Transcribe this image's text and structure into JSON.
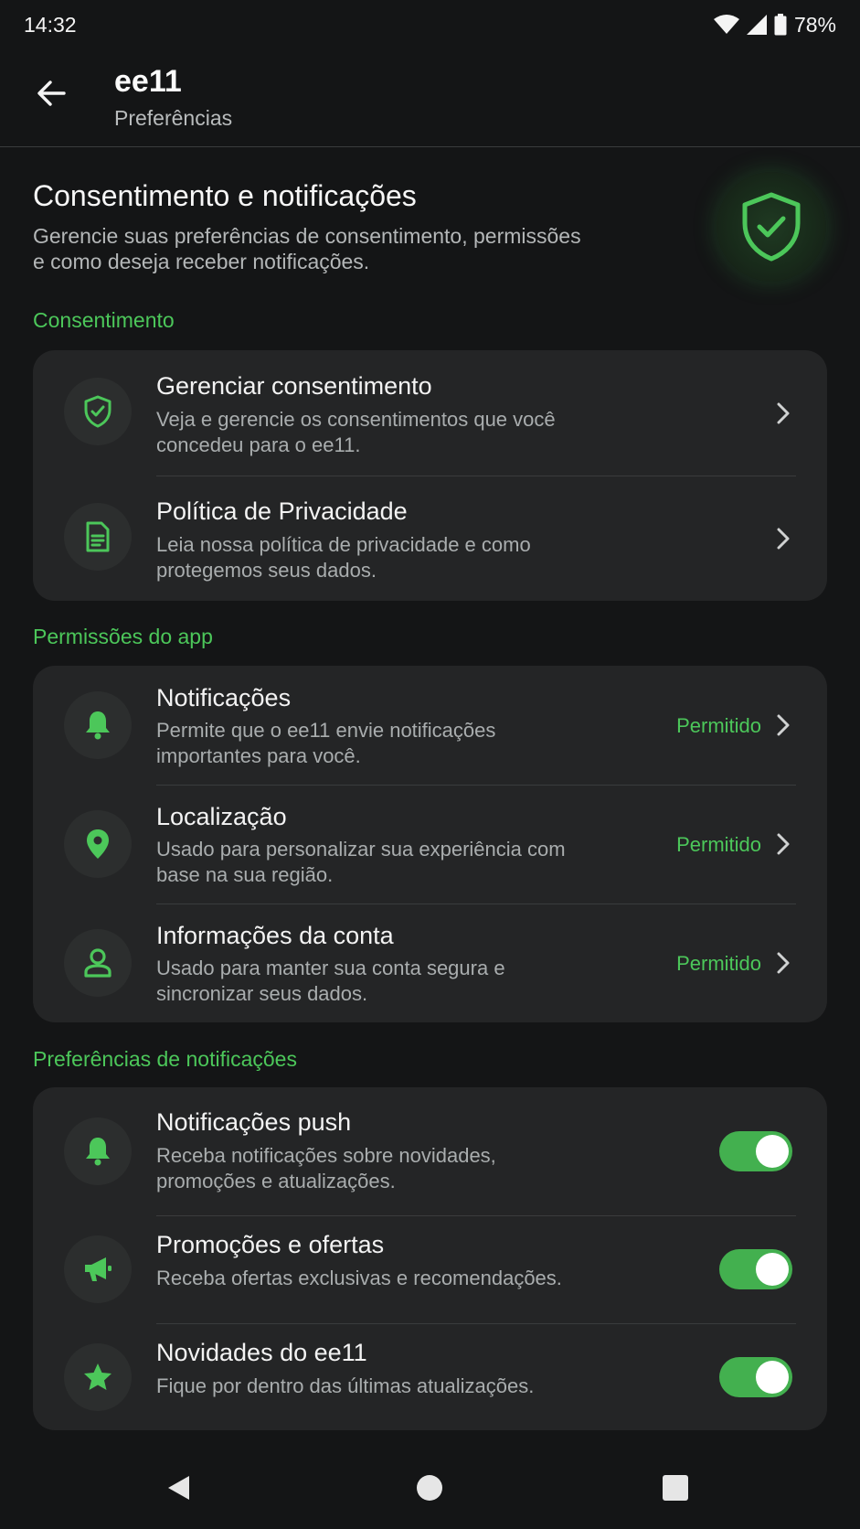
{
  "status_bar": {
    "time": "14:32",
    "battery": "78%"
  },
  "app_bar": {
    "title": "ee11",
    "subtitle": "Preferências"
  },
  "hero": {
    "title": "Consentimento e notificações",
    "description": "Gerencie suas preferências de consentimento, permissões e como deseja receber notificações."
  },
  "sections": {
    "consent": {
      "label": "Consentimento",
      "items": [
        {
          "icon": "shield-check-icon",
          "title": "Gerenciar consentimento",
          "description": "Veja e gerencie os consentimentos que você concedeu para o ee11."
        },
        {
          "icon": "document-icon",
          "title": "Política de Privacidade",
          "description": "Leia nossa política de privacidade e como protegemos seus dados."
        }
      ]
    },
    "permissions": {
      "label": "Permissões do app",
      "items": [
        {
          "icon": "bell-icon",
          "title": "Notificações",
          "description": "Permite que o ee11 envie notificações importantes para você.",
          "status": "Permitido"
        },
        {
          "icon": "location-pin-icon",
          "title": "Localização",
          "description": "Usado para personalizar sua experiência com base na sua região.",
          "status": "Permitido"
        },
        {
          "icon": "person-icon",
          "title": "Informações da conta",
          "description": "Usado para manter sua conta segura e sincronizar seus dados.",
          "status": "Permitido"
        }
      ]
    },
    "notifications": {
      "label": "Preferências de notificações",
      "items": [
        {
          "icon": "bell-icon",
          "title": "Notificações push",
          "description": "Receba notificações sobre novidades, promoções e atualizações.",
          "enabled": true
        },
        {
          "icon": "megaphone-icon",
          "title": "Promoções e ofertas",
          "description": "Receba ofertas exclusivas e recomendações.",
          "enabled": true
        },
        {
          "icon": "star-icon",
          "title": "Novidades do ee11",
          "description": "Fique por dentro das últimas atualizações.",
          "enabled": true
        }
      ]
    }
  },
  "colors": {
    "accent": "#4cc75a",
    "background": "#141516",
    "card": "#242526",
    "toggle_on": "#43b04f"
  }
}
